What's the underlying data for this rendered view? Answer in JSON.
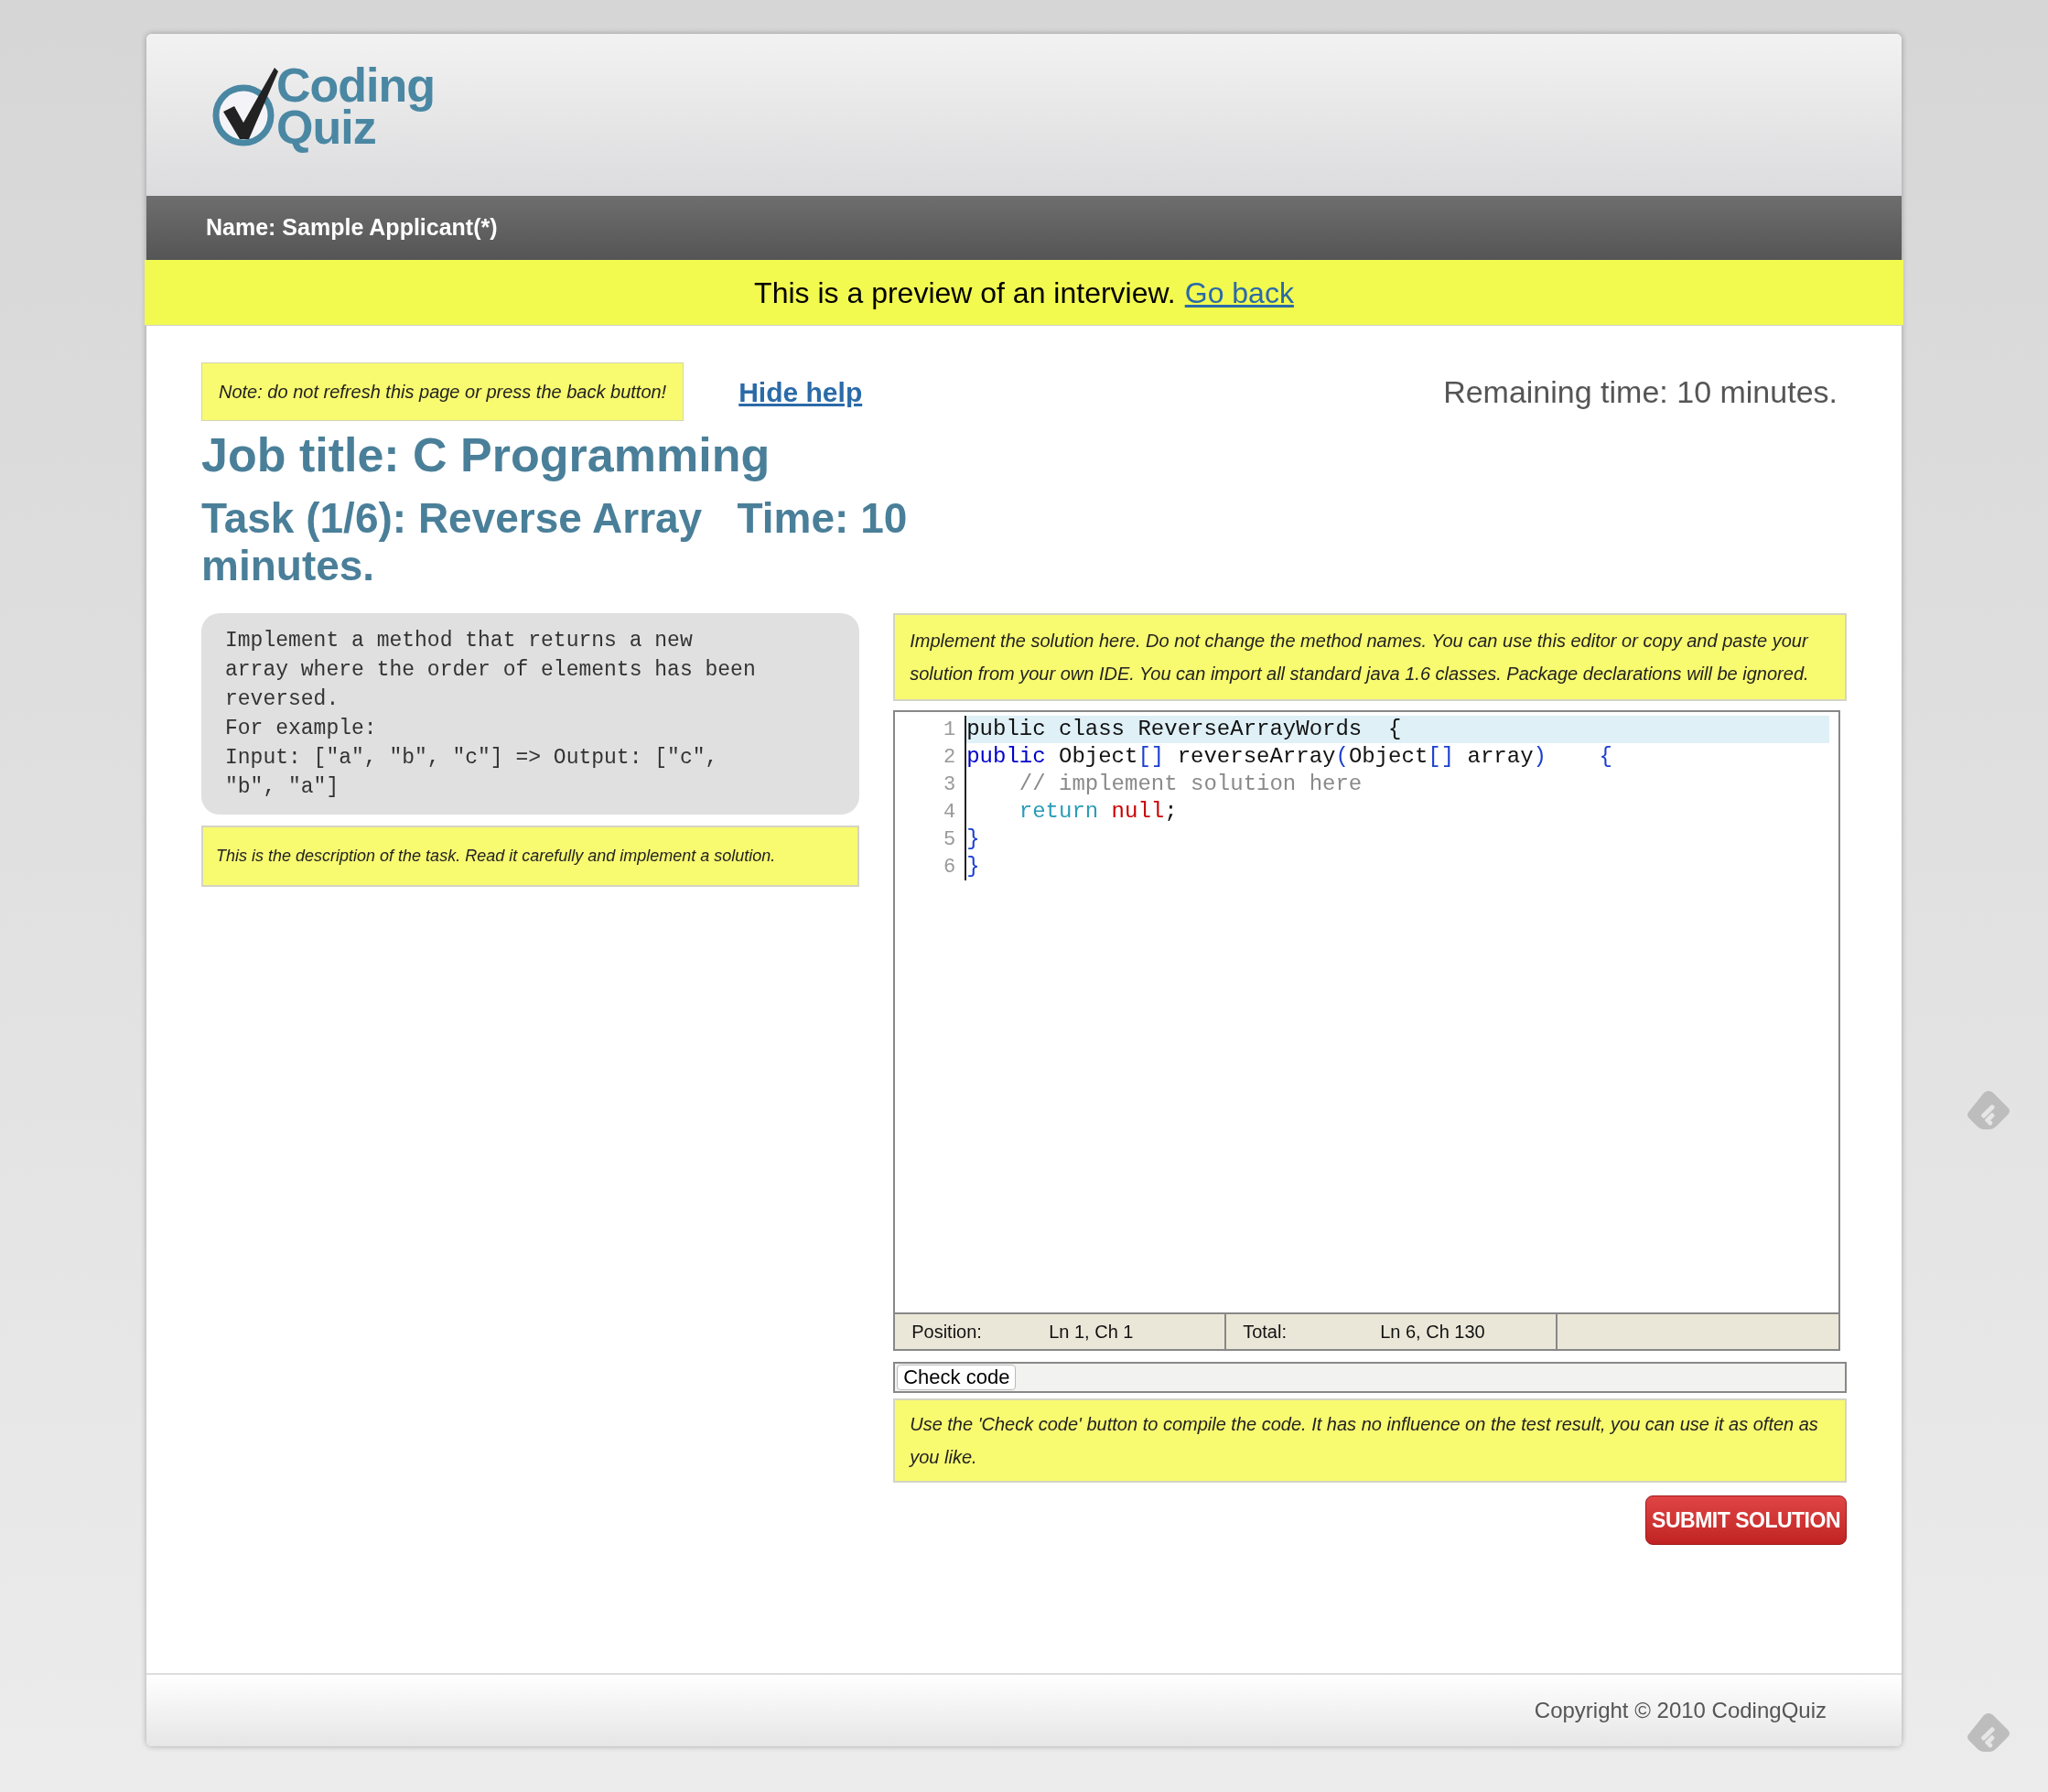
{
  "logo": {
    "lines": [
      "Coding",
      "Quiz"
    ]
  },
  "name_bar": "Name: Sample Applicant(*)",
  "preview_banner": {
    "text": "This is a preview of an interview.",
    "link": "Go back"
  },
  "note": "Note: do not refresh this page or press the back button!",
  "hide_help": "Hide help",
  "remaining_time": "Remaining time: 10 minutes.",
  "job_title": "Job title: C Programming",
  "task_title": "Task (1/6): Reverse Array   Time: 10 minutes.",
  "description": {
    "lines": [
      "Implement a method that returns a new",
      "array where the order of elements has been",
      "reversed.",
      "For example:",
      "Input: [\"a\", \"b\", \"c\"] => Output: [\"c\",",
      "\"b\", \"a\"]"
    ]
  },
  "description_help": "This is the description of the task. Read it carefully and implement a solution.",
  "editor_help": "Implement the solution here. Do not change the method names. You can use this editor or copy and paste your solution from your own IDE. You can import all standard java 1.6 classes. Package declarations will be ignored.",
  "editor": {
    "lines": [
      {
        "number": "1",
        "highlighted": true,
        "tokens": [
          {
            "kind": "plain",
            "text": "public class ReverseArrayWords  {"
          }
        ]
      },
      {
        "number": "2",
        "highlighted": false,
        "tokens": [
          {
            "kind": "keyword",
            "text": "public"
          },
          {
            "kind": "plain",
            "text": " Object"
          },
          {
            "kind": "bracket",
            "text": "[]"
          },
          {
            "kind": "plain",
            "text": " reverseArray"
          },
          {
            "kind": "bracket",
            "text": "("
          },
          {
            "kind": "plain",
            "text": "Object"
          },
          {
            "kind": "bracket",
            "text": "[]"
          },
          {
            "kind": "plain",
            "text": " array"
          },
          {
            "kind": "bracket",
            "text": ")    {"
          }
        ]
      },
      {
        "number": "3",
        "highlighted": false,
        "tokens": [
          {
            "kind": "comment",
            "text": "    // implement solution here"
          }
        ]
      },
      {
        "number": "4",
        "highlighted": false,
        "tokens": [
          {
            "kind": "return",
            "text": "    return"
          },
          {
            "kind": "literal",
            "text": " null"
          },
          {
            "kind": "plain",
            "text": ";"
          }
        ]
      },
      {
        "number": "5",
        "highlighted": false,
        "tokens": [
          {
            "kind": "bracket",
            "text": "}"
          }
        ]
      },
      {
        "number": "6",
        "highlighted": false,
        "tokens": [
          {
            "kind": "bracket",
            "text": "}"
          }
        ]
      }
    ]
  },
  "status_bar": [
    {
      "label": "Position:",
      "value": "Ln 1, Ch 1"
    },
    {
      "label": "Total:",
      "value": "Ln 6, Ch 130"
    }
  ],
  "check_code_button": "Check code",
  "check_help": "Use the 'Check code' button to compile the code. It has no influence on the test result, you can use it as often as you like.",
  "submit_button": "SUBMIT SOLUTION",
  "footer": "Copyright © 2010 CodingQuiz"
}
